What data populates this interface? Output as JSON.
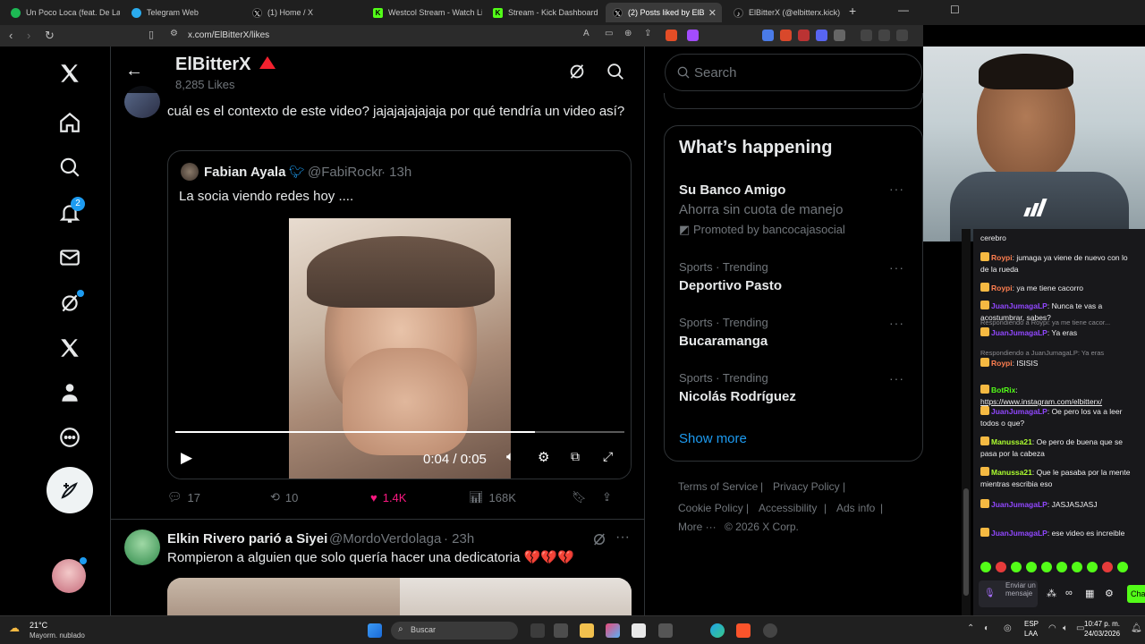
{
  "browser": {
    "tabs": [
      {
        "label": "Un Poco Loca (feat. De La",
        "icon": "spotify-icon",
        "color": "#1db954"
      },
      {
        "label": "Telegram Web",
        "icon": "telegram-icon",
        "color": "#2aabee"
      },
      {
        "label": "(1) Home / X",
        "icon": "x-icon",
        "color": "#ffffff"
      },
      {
        "label": "Westcol Stream - Watch Live",
        "icon": "kick-icon",
        "color": "#53fc18"
      },
      {
        "label": "Stream - Kick Dashboard",
        "icon": "kick-icon",
        "color": "#53fc18"
      },
      {
        "label": "(2) Posts liked by ElB",
        "icon": "x-icon",
        "color": "#ffffff",
        "active": true
      },
      {
        "label": "ElBitterX (@elbitterx.kick) | T",
        "icon": "tiktok-icon",
        "color": "#ffffff"
      }
    ],
    "url": "x.com/ElBitterX/likes"
  },
  "header": {
    "name": "ElBitterX",
    "likes": "8,285 Likes"
  },
  "sidebar": {
    "notification_count": "2"
  },
  "tweet1": {
    "text": "cuál es el contexto de este video? jajajajajajaja por qué tendría un video así?",
    "quote": {
      "name": "Fabian Ayala",
      "handle": "@FabiRockr",
      "time": "· 13h",
      "text": "La socia viendo redes hoy ....",
      "video_time": "0:04 / 0:05",
      "video_progress": 0.8
    },
    "replies": "17",
    "retweets": "10",
    "likes": "1.4K",
    "views": "168K"
  },
  "tweet2": {
    "name": "Elkin Rivero parió a Siyei",
    "handle": "@MordoVerdolaga",
    "time": "· 23h",
    "text": "Rompieron a alguien que solo quería hacer una dedicatoria 💔💔💔"
  },
  "search": {
    "placeholder": "Search"
  },
  "happening": {
    "title": "What’s happening",
    "promo": {
      "title": "Su Banco Amigo",
      "subtitle": "Ahorra sin cuota de manejo",
      "promoted": "Promoted by bancocajasocial"
    },
    "trends": [
      {
        "meta": "Sports · Trending",
        "title": "Deportivo Pasto"
      },
      {
        "meta": "Sports · Trending",
        "title": "Bucaramanga"
      },
      {
        "meta": "Sports · Trending",
        "title": "Nicolás Rodríguez"
      }
    ],
    "show_more": "Show more"
  },
  "footer": {
    "links": [
      "Terms of Service",
      "Privacy Policy",
      "Cookie Policy",
      "Accessibility",
      "Ads info",
      "More ···"
    ],
    "copyright": "© 2026 X Corp."
  },
  "chat": {
    "messages": [
      {
        "user": "Roypi",
        "color": "#ff7f50",
        "text": "jumaga ya viene de nuevo con lo de la rueda"
      },
      {
        "user": "Roypi",
        "color": "#ff7f50",
        "text": "ya me tiene cacorro"
      },
      {
        "user": "JuanJumagaLP",
        "color": "#9147ff",
        "text": "Nunca te vas a acostumbrar, sabes?"
      },
      {
        "reply": "Respondiendo a Roypi: ya me tiene cacor...",
        "user": "JuanJumagaLP",
        "color": "#9147ff",
        "text": "Ya eras"
      },
      {
        "reply": "Respondiendo a JuanJumagaLP: Ya eras",
        "user": "Roypi",
        "color": "#ff7f50",
        "text": "ISISIS"
      },
      {
        "user": "BotRix",
        "color": "#53fc18",
        "text": "https://www.instagram.com/elbitterx/"
      },
      {
        "user": "JuanJumagaLP",
        "color": "#9147ff",
        "text": "Oe pero los va a leer todos o que?"
      },
      {
        "user": "Manussa21",
        "color": "#adff2f",
        "text": "Oe pero de buena que se pasa por la cabeza"
      },
      {
        "user": "Manussa21",
        "color": "#adff2f",
        "text": "Que le pasaba por la mente mientras escribia eso"
      },
      {
        "user": "JuanJumagaLP",
        "color": "#9147ff",
        "text": "JASJASJASJ"
      },
      {
        "user": "JuanJumagaLP",
        "color": "#9147ff",
        "text": "ese video es increible"
      }
    ],
    "top_partial": "cerebro",
    "input_placeholder": "Enviar un mensaje",
    "send_label": "Cha"
  },
  "taskbar": {
    "weather_temp": "21°C",
    "weather_desc": "Mayorm. nublado",
    "search": "Buscar",
    "lang": "ESP",
    "lang2": "LAA",
    "time": "10:47 p. m.",
    "date": "24/03/2026"
  }
}
